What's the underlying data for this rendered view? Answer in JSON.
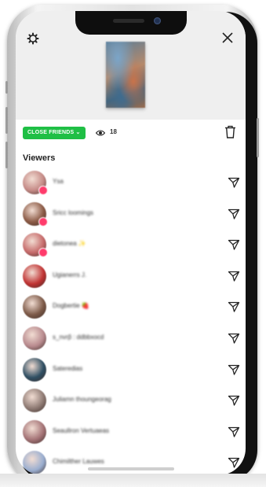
{
  "header": {
    "settings_icon": "gear-icon",
    "close_icon": "close-icon"
  },
  "controls": {
    "close_friends_label": "CLOSE FRIENDS ⌄",
    "view_count": "18",
    "eye_icon": "eye-icon",
    "delete_icon": "trash-icon",
    "accent_color": "#1fbf45"
  },
  "viewers": {
    "title": "Viewers",
    "items": [
      {
        "name": "Ysa",
        "color": "#c58a86",
        "badge": true
      },
      {
        "name": "Sricc loomings",
        "color": "#8b5a45",
        "badge": true
      },
      {
        "name": "dietonea ✨",
        "color": "#c66a6a",
        "badge": true
      },
      {
        "name": "Ugianerrs J.",
        "color": "#c03232",
        "badge": false
      },
      {
        "name": "Dogbertie 🍓",
        "color": "#7d5a48",
        "badge": false
      },
      {
        "name": "s_nvrp̃ : ddbbxocd",
        "color": "#b88a8e",
        "badge": false
      },
      {
        "name": "Sateredias",
        "color": "#2f4f63",
        "badge": false
      },
      {
        "name": "Juliamn thoungeorag",
        "color": "#8f7b74",
        "badge": false
      },
      {
        "name": "Seaullron Vertuaeas",
        "color": "#a47376",
        "badge": false
      },
      {
        "name": "Chimilther Lauwes",
        "color": "#9aaed0",
        "badge": false
      }
    ]
  }
}
